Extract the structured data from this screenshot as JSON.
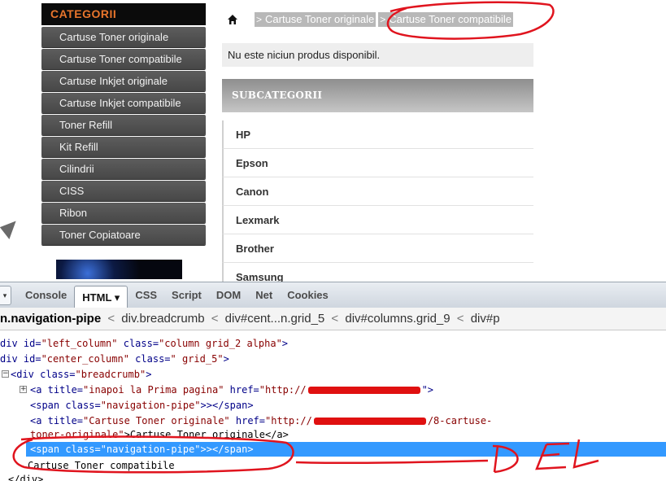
{
  "sidebar": {
    "header": "CATEGORII",
    "items": [
      "Cartuse Toner originale",
      "Cartuse Toner compatibile",
      "Cartuse Inkjet originale",
      "Cartuse Inkjet compatibile",
      "Toner Refill",
      "Kit Refill",
      "Cilindrii",
      "CISS",
      "Ribon",
      "Toner Copiatoare"
    ]
  },
  "breadcrumb": {
    "home_icon": "home-icon",
    "pipe": ">",
    "crumb1": "Cartuse Toner originale",
    "crumb2": "Cartuse Toner compatibile"
  },
  "main": {
    "no_product": "Nu este niciun produs disponibil.",
    "subcat_header": "SUBCATEGORII",
    "subcategories": [
      "HP",
      "Epson",
      "Canon",
      "Lexmark",
      "Brother",
      "Samsung"
    ]
  },
  "devtools": {
    "menu_glyph": "▾",
    "tabs": [
      "Console",
      "HTML ▾",
      "CSS",
      "Script",
      "DOM",
      "Net",
      "Cookies"
    ],
    "path": {
      "current": "n.navigation-pipe",
      "sep": "<",
      "p1": "div.breadcrumb",
      "p2": "div#cent...n.grid_5",
      "p3": "div#columns.grid_9",
      "p4": "div#p"
    },
    "code": {
      "l0_tag_open": "div id=",
      "l0_id": "\"left_column\"",
      "l0_cls": " class=",
      "l0_clsval": "\"column grid_2 alpha\"",
      "l0_close": ">",
      "l1_tag_open": "div id=",
      "l1_id": "\"center_column\"",
      "l1_cls": " class=",
      "l1_clsval": "\" grid_5\"",
      "l1_close": ">",
      "l2_twisty": "−",
      "l2_tag": "<div class=",
      "l2_val": "\"breadcrumb\"",
      "l2_close": ">",
      "l3_twisty": "+",
      "l3_tag": "<a title=",
      "l3_val": "\"inapoi la Prima pagina\"",
      "l3_href": " href=",
      "l3_hrefval": "\"http://",
      "l3_end": "\">",
      "l4_tag": "<span class=",
      "l4_val": "\"navigation-pipe\"",
      "l4_close": ">></span>",
      "l5_tag": "<a title=",
      "l5_val": "\"Cartuse Toner originale\"",
      "l5_href": " href=",
      "l5_hrefval": "\"http://",
      "l5_tail": "/8-cartuse-",
      "l6_tail": "toner-originale\"",
      "l6_text": ">Cartuse Toner originale</a>",
      "l7_tag": "<span class=",
      "l7_val": "\"navigation-pipe\"",
      "l7_close": ">></span>",
      "l8_text": "Cartuse Toner compatibile",
      "l9_text": "</div>"
    }
  },
  "annotation": {
    "label": "DEL",
    "color": "#e0141e"
  },
  "colors": {
    "sidebar_header_text": "#e8752c",
    "sidebar_item_bg": "#505050",
    "selected_row": "#3399ff",
    "annotation_red": "#e0141e"
  }
}
